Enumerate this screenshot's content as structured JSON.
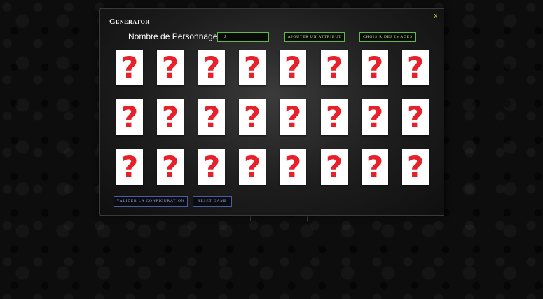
{
  "background": {
    "button_label": "MODE DE JEUX SOLO"
  },
  "modal": {
    "title": "Generator",
    "close_label": "x",
    "count_label": "Nombre de Personnages :",
    "count_value": "0",
    "add_attribute_label": "Ajouter un attribut",
    "choose_images_label": "Choisir des images",
    "validate_label": "Valider la configuration",
    "reset_label": "Reset game"
  },
  "cards": {
    "rows": 3,
    "columns": 8,
    "glyph": "?",
    "icon": "question-mark-icon",
    "glyph_color": "#e8202a"
  }
}
